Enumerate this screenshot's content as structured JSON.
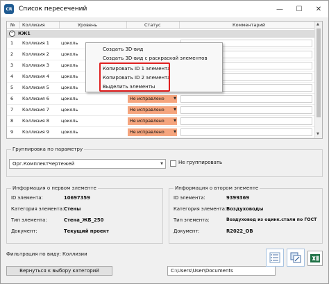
{
  "window": {
    "title": "Список пересечений",
    "icon_text": "CR",
    "min": "—",
    "max": "☐",
    "close": "✕"
  },
  "grid": {
    "headers": {
      "num": "№",
      "collision": "Коллизия",
      "level": "Уровень",
      "status": "Статус",
      "comment": "Комментарий"
    },
    "group_label": "КЖ1",
    "rows": [
      {
        "num": "1",
        "name": "Коллизия 1",
        "level": "цоколь",
        "status": ""
      },
      {
        "num": "2",
        "name": "Коллизия 2",
        "level": "цоколь",
        "status": ""
      },
      {
        "num": "3",
        "name": "Коллизия 3",
        "level": "цоколь",
        "status": ""
      },
      {
        "num": "4",
        "name": "Коллизия 4",
        "level": "цоколь",
        "status": ""
      },
      {
        "num": "5",
        "name": "Коллизия 5",
        "level": "цоколь",
        "status": ""
      },
      {
        "num": "6",
        "name": "Коллизия 6",
        "level": "цоколь",
        "status": "Не исправлено"
      },
      {
        "num": "7",
        "name": "Коллизия 7",
        "level": "цоколь",
        "status": "Не исправлено"
      },
      {
        "num": "8",
        "name": "Коллизия 8",
        "level": "цоколь",
        "status": "Не исправлено"
      },
      {
        "num": "9",
        "name": "Коллизия 9",
        "level": "цоколь",
        "status": "Не исправлено"
      },
      {
        "num": "10",
        "name": "Коллизия 10",
        "level": "цоколь",
        "status": "Не исправлено"
      }
    ],
    "status_color": "#f5a57e"
  },
  "context_menu": {
    "items": [
      "Создать 3D-вид",
      "Создать 3D-вид с раскраской элементов",
      "Копировать ID 1 элемента",
      "Копировать ID 2 элемента",
      "Выделить элементы"
    ],
    "highlight_color": "#e02020"
  },
  "grouping": {
    "legend": "Группировка по параметру",
    "selected": "Орг.КомплектЧертежей",
    "no_group_label": "Не группировать"
  },
  "first": {
    "legend": "Информация о первом элементе",
    "labels": [
      "ID элемента:",
      "Категория элемента:",
      "Тип элемента:",
      "Документ:"
    ],
    "values": [
      "10697359",
      "Стены",
      "Стена_ЖБ_250",
      "Текущий проект"
    ]
  },
  "second": {
    "legend": "Информация о втором элементе",
    "labels": [
      "ID элемента:",
      "Категория элемента:",
      "Тип элемента:",
      "Документ:"
    ],
    "values": [
      "9399369",
      "Воздуховоды",
      "Воздуховод из оцинк.стали по ГОСТ",
      "R2022_OB"
    ]
  },
  "footer": {
    "filter_text": "Фильтрация по виду: Коллизии",
    "back_button": "Вернуться к выбору категорий",
    "path": "C:\\Users\\User\\Documents"
  }
}
